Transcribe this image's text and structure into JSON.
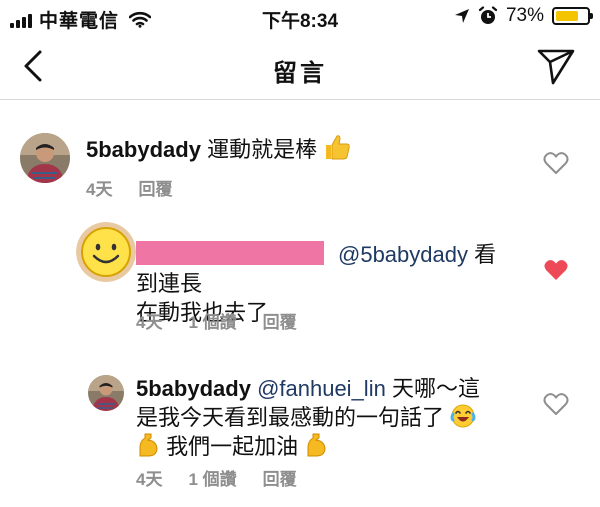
{
  "status_bar": {
    "carrier": "中華電信",
    "time": "下午8:34",
    "battery_percent": "73%",
    "battery_level": 0.73
  },
  "nav": {
    "title": "留言",
    "back_icon": "chevron-left-icon",
    "send_icon": "paper-plane-icon"
  },
  "comments": [
    {
      "username": "5babydady",
      "text": "運動就是棒",
      "emoji": "thumbs-up-icon",
      "time": "4天",
      "reply_label": "回覆",
      "liked": false
    },
    {
      "mention": "@5babydady",
      "text_line1": "看到連長",
      "text_line2": "在動我也去了",
      "time": "4天",
      "likes_label": "1 個讚",
      "reply_label": "回覆",
      "liked": true,
      "like_color": "#ed4956"
    },
    {
      "username": "5babydady",
      "mention": "@fanhuei_lin",
      "text_line1": "天哪～這",
      "text_line2": "是我今天看到最感動的一句話了",
      "text_line3": "我們一起加油",
      "emoji_1": "laughing-crying-icon",
      "emoji_2": "flexed-biceps-icon",
      "time": "4天",
      "likes_label": "1 個讚",
      "reply_label": "回覆",
      "liked": false
    }
  ]
}
